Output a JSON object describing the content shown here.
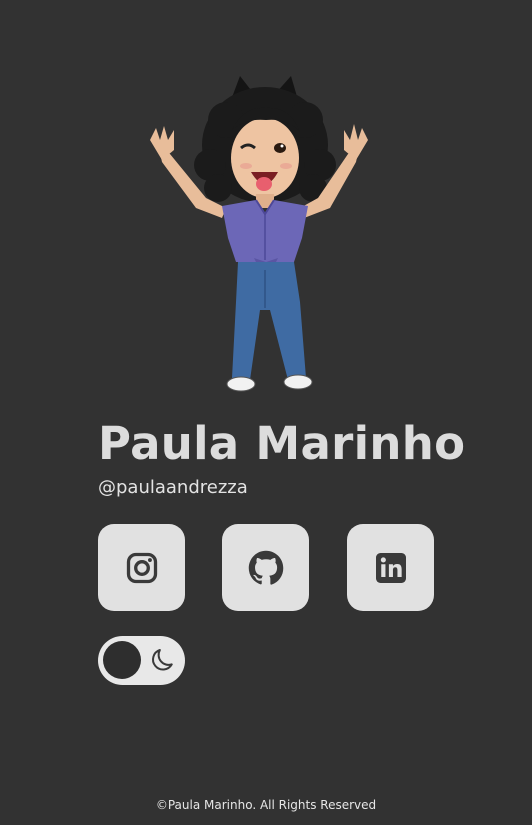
{
  "profile": {
    "name": "Paula Marinho",
    "handle": "@paulaandrezza",
    "avatar_icon": "bitmoji-avatar"
  },
  "social_links": [
    {
      "name": "instagram",
      "icon": "instagram-icon"
    },
    {
      "name": "github",
      "icon": "github-icon"
    },
    {
      "name": "linkedin",
      "icon": "linkedin-icon"
    }
  ],
  "theme_toggle": {
    "icon": "moon-icon",
    "mode": "dark"
  },
  "footer": {
    "text": "©Paula Marinho. All Rights Reserved"
  },
  "colors": {
    "background": "#323232",
    "card": "#e1e1e1",
    "icon": "#3a3a3a",
    "text": "#dcdcdc"
  }
}
